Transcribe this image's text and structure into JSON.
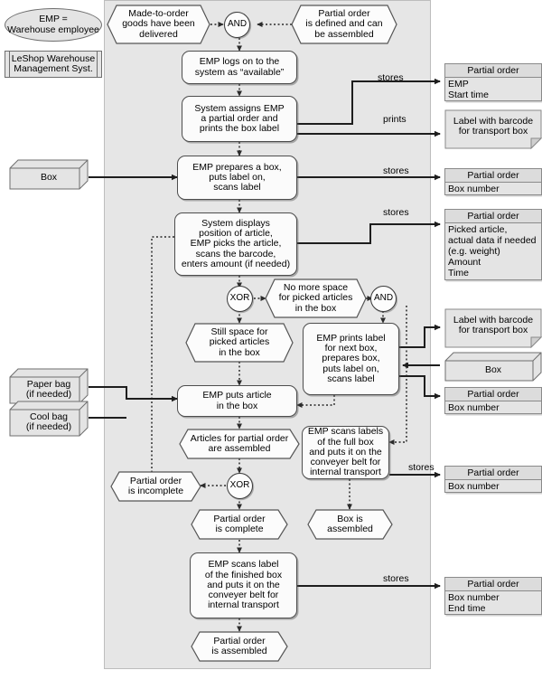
{
  "diagram": {
    "title": "LeShop Warehouse order-picking EPC",
    "colors": {
      "pool_fill": "#e6e6e6",
      "node_fill": "#fbfbfb",
      "data_fill": "#e4e4e4",
      "line": "#2b2b2b",
      "dotted_line": "#4d4d4d"
    }
  },
  "legend": {
    "role": "EMP =\nWarehouse employee",
    "system": "LeShop Warehouse\nManagement Syst."
  },
  "events": {
    "made_to_order": "Made-to-order\ngoods have been\ndelivered",
    "partial_order_defined": "Partial order\nis defined and can\nbe assembled",
    "no_more_space": "No more space\nfor picked articles\nin the box",
    "still_space": "Still space for\npicked articles\nin the box",
    "articles_assembled": "Articles for partial order\nare assembled",
    "partial_order_incomplete": "Partial order\nis incomplete",
    "partial_order_complete": "Partial order\nis complete",
    "box_assembled": "Box is\nassembled",
    "partial_order_assembled": "Partial order\nis assembled"
  },
  "functions": {
    "emp_logs_on": "EMP logs on to the\nsystem as “available”",
    "system_assigns": "System assigns EMP\na partial order and\nprints the box label",
    "emp_prepares_box": "EMP prepares a box,\nputs label on,\nscans label",
    "system_displays": "System displays\nposition of article,\nEMP picks the article,\nscans the barcode,\nenters amount (if needed)",
    "emp_prints_label_next": "EMP prints label\nfor next box,\nprepares box,\nputs label on,\nscans  label",
    "emp_puts_article": "EMP puts article\nin the box",
    "emp_scans_full_box": "EMP scans labels\nof the full box\nand puts it on the\nconveyer belt for\ninternal transport",
    "emp_scans_finished_box": "EMP scans label\nof the finished box\nand puts it on the\nconveyer belt for\ninternal transport"
  },
  "connectors": {
    "and_top": "AND",
    "xor_space": "XOR",
    "and_space": "AND",
    "xor_complete": "XOR"
  },
  "data_objects": [
    {
      "name": "partial-order-start",
      "header": "Partial order",
      "body": "EMP\nStart time"
    },
    {
      "name": "partial-order-box-number-1",
      "header": "Partial order",
      "body": "Box number"
    },
    {
      "name": "partial-order-picked-article",
      "header": "Partial order",
      "body": "Picked article,\nactual data  if needed\n(e.g. weight)\nAmount\nTime"
    },
    {
      "name": "partial-order-box-number-2",
      "header": "Partial order",
      "body": "Box number"
    },
    {
      "name": "partial-order-box-number-3",
      "header": "Partial order",
      "body": "Box number"
    },
    {
      "name": "partial-order-end",
      "header": "Partial order",
      "body": "Box number\nEnd time"
    }
  ],
  "documents": {
    "label_barcode_1": "Label with barcode\nfor transport box",
    "label_barcode_2": "Label with barcode\nfor transport box"
  },
  "resources": {
    "box_1": "Box",
    "box_2": "Box",
    "paper_bag": "Paper bag\n(if needed)",
    "cool_bag": "Cool bag\n(if needed)"
  },
  "edge_labels": {
    "stores_1": "stores",
    "prints_1": "prints",
    "stores_2": "stores",
    "stores_3": "stores",
    "stores_4": "stores",
    "stores_5": "stores"
  }
}
